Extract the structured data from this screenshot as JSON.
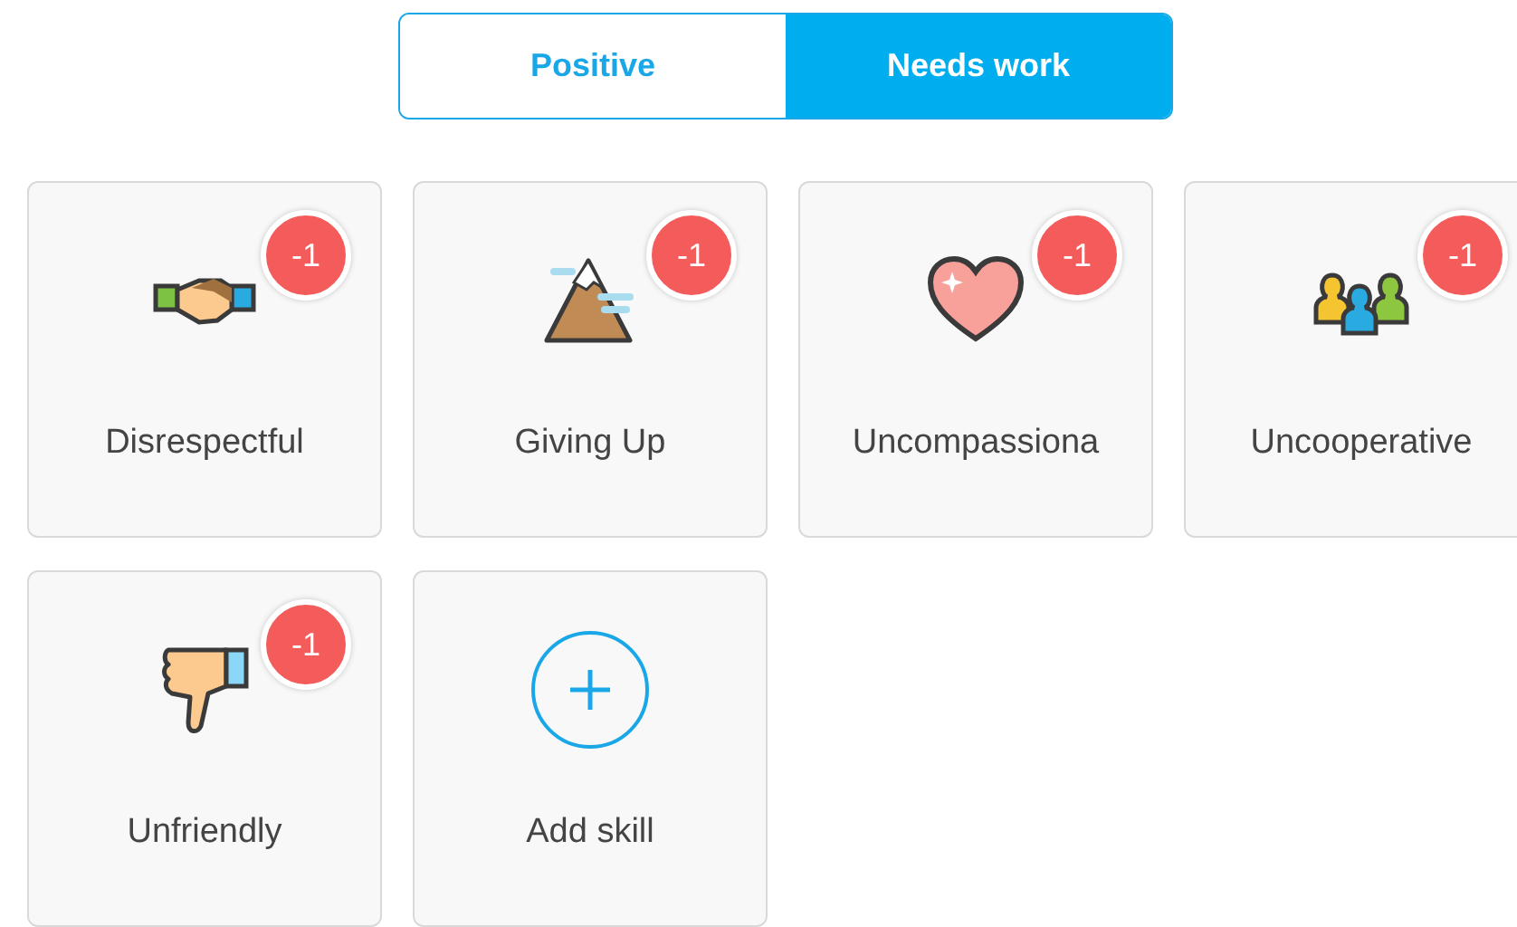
{
  "tabs": [
    {
      "label": "Positive",
      "selected": false
    },
    {
      "label": "Needs work",
      "selected": true
    }
  ],
  "cards": [
    {
      "kind": "skill",
      "label": "Disrespectful",
      "badge": "-1"
    },
    {
      "kind": "skill",
      "label": "Giving Up",
      "badge": "-1"
    },
    {
      "kind": "skill",
      "label": "Uncompassiona",
      "badge": "-1"
    },
    {
      "kind": "skill",
      "label": "Uncooperative",
      "badge": "-1"
    },
    {
      "kind": "skill",
      "label": "Unfriendly",
      "badge": "-1"
    },
    {
      "kind": "add",
      "label": "Add skill"
    }
  ]
}
